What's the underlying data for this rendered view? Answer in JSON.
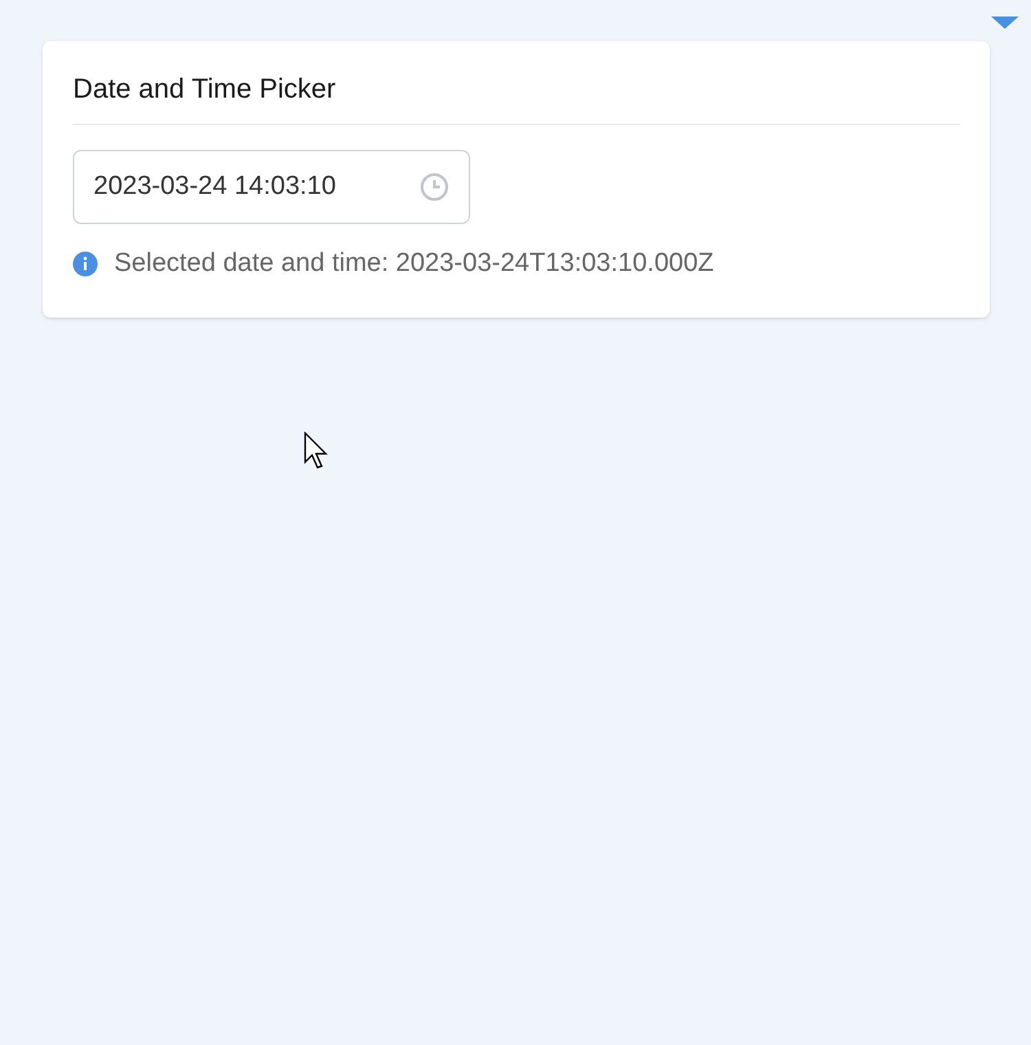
{
  "card": {
    "title": "Date and Time Picker"
  },
  "picker": {
    "value": "2023-03-24 14:03:10"
  },
  "info": {
    "text": "Selected date and time: 2023-03-24T13:03:10.000Z"
  }
}
